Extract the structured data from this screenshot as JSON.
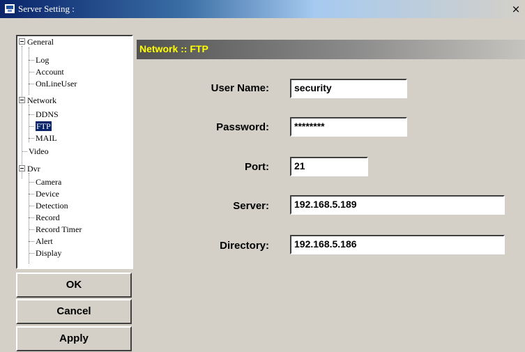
{
  "window": {
    "title": "Server Setting :",
    "close_glyph": "×"
  },
  "tree": {
    "general": "General",
    "log": "Log",
    "account": "Account",
    "onlineuser": "OnLineUser",
    "network": "Network",
    "ddns": "DDNS",
    "ftp": "FTP",
    "mail": "MAIL",
    "video": "Video",
    "dvr": "Dvr",
    "camera": "Camera",
    "device": "Device",
    "detection": "Detection",
    "record": "Record",
    "record_timer": "Record Timer",
    "alert": "Alert",
    "display": "Display",
    "selected": "FTP"
  },
  "panel": {
    "header": "Network :: FTP"
  },
  "form": {
    "user_name_label": "User Name:",
    "user_name_value": "security",
    "password_label": "Password:",
    "password_value": "********",
    "port_label": "Port:",
    "port_value": "21",
    "server_label": "Server:",
    "server_value": "192.168.5.189",
    "directory_label": "Directory:",
    "directory_value": "192.168.5.186"
  },
  "buttons": {
    "ok": "OK",
    "cancel": "Cancel",
    "apply": "Apply"
  },
  "colors": {
    "title_bar": "#0a246a",
    "header_text": "#ffff00",
    "window_bg": "#d4d0c8",
    "selection": "#0a246a"
  }
}
